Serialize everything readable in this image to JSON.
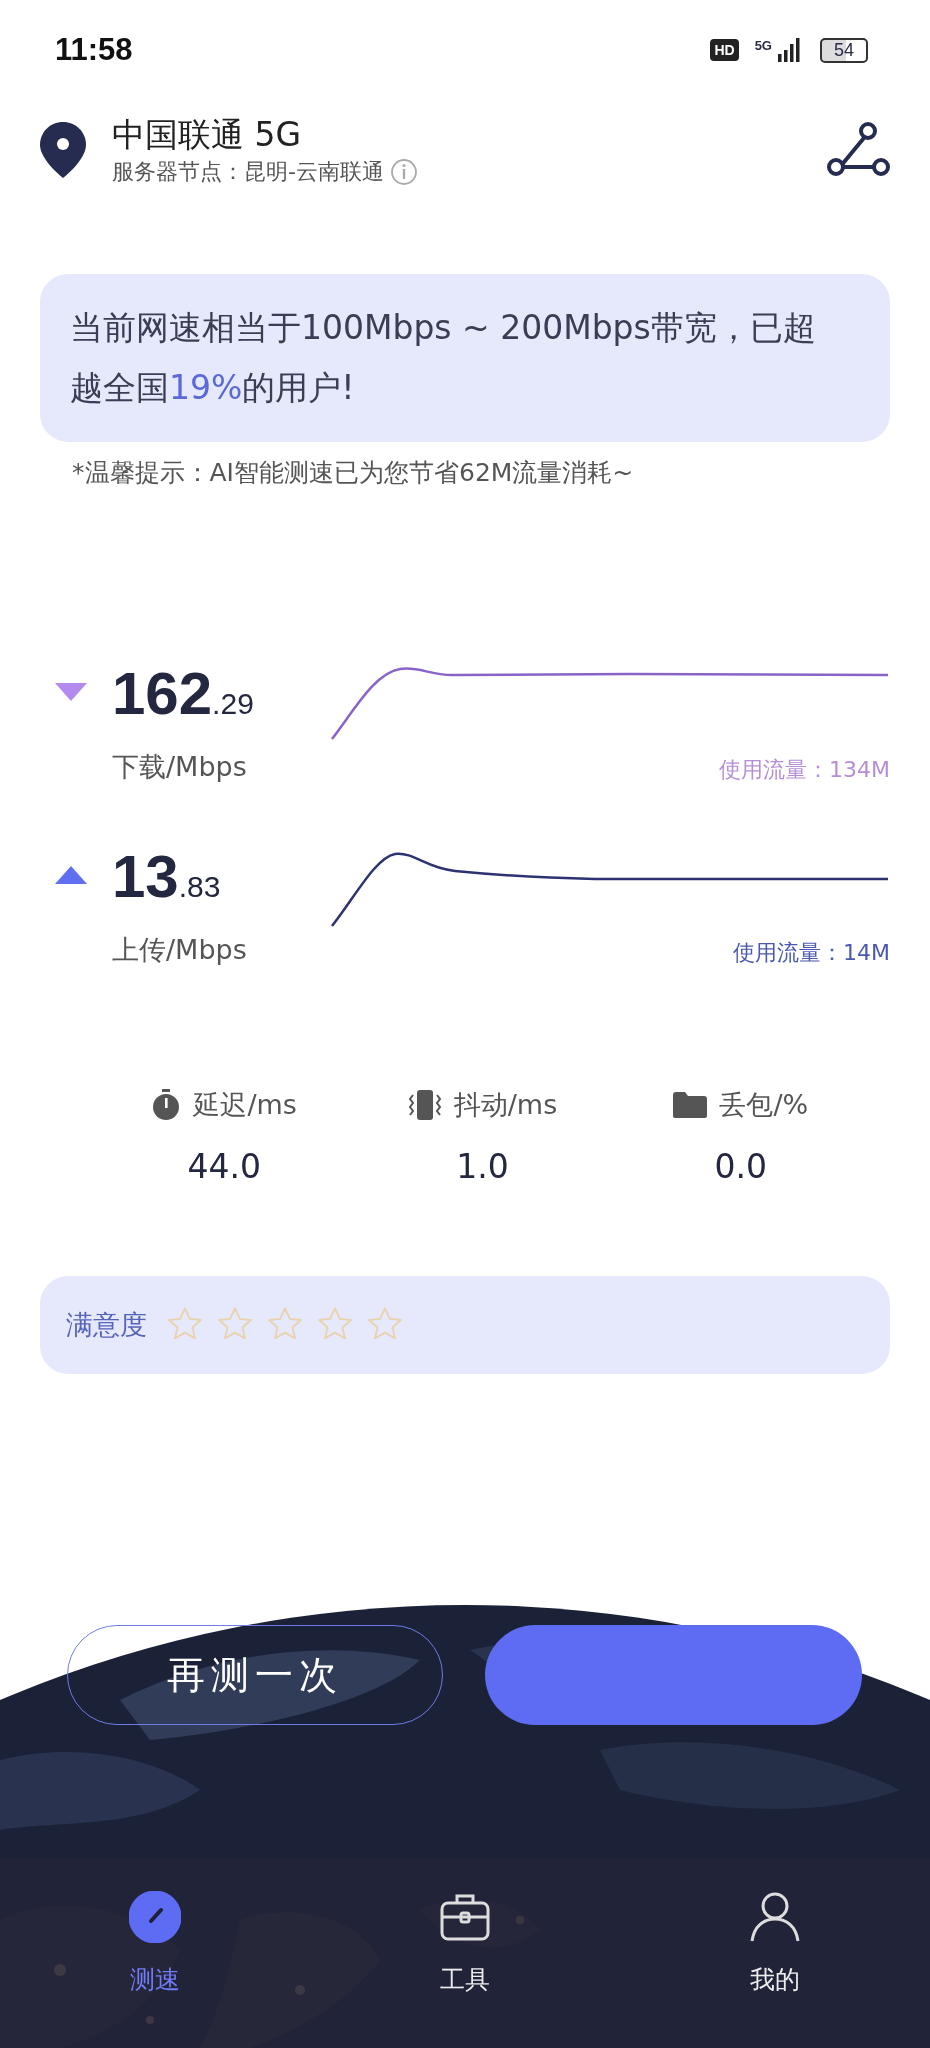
{
  "status_bar": {
    "time": "11:58",
    "hd_badge": "HD",
    "network": "5G",
    "battery": "54"
  },
  "header": {
    "carrier": "中国联通 5G",
    "server": "服务器节点：昆明-云南联通"
  },
  "banner": {
    "before": "当前网速相当于100Mbps ~ 200Mbps带宽，已超越全国",
    "highlight": "19%",
    "after": "的用户!"
  },
  "tip": "*温馨提示：AI智能测速已为您节省62M流量消耗~",
  "speeds": [
    {
      "kind": "download",
      "value": "162",
      "decimal": ".29",
      "unit": "下载/Mbps",
      "usage": "使用流量：134M",
      "color": "#b48af0"
    },
    {
      "kind": "upload",
      "value": "13",
      "decimal": ".83",
      "unit": "上传/Mbps",
      "usage": "使用流量：14M",
      "color": "#5f6ff0"
    }
  ],
  "metrics": [
    {
      "kind": "latency",
      "label": "延迟/ms",
      "value": "44.0"
    },
    {
      "kind": "jitter",
      "label": "抖动/ms",
      "value": "1.0"
    },
    {
      "kind": "loss",
      "label": "丢包/%",
      "value": "0.0"
    }
  ],
  "rating": {
    "label": "满意度",
    "stars": 0
  },
  "retest_button": "再测一次",
  "nav": [
    {
      "kind": "speed",
      "label": "测速",
      "selected": true
    },
    {
      "kind": "tools",
      "label": "工具",
      "selected": false
    },
    {
      "kind": "profile",
      "label": "我的",
      "selected": false
    }
  ]
}
